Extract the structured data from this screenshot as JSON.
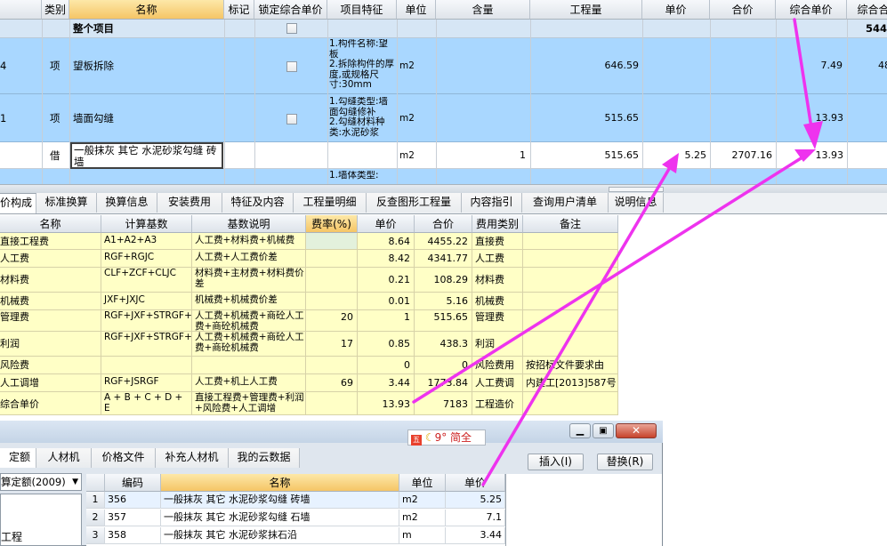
{
  "top_grid": {
    "headers": [
      "类别",
      "名称",
      "标记",
      "锁定综合单价",
      "项目特征",
      "单位",
      "含量",
      "工程量",
      "单价",
      "合价",
      "综合单价",
      "综合合"
    ],
    "summary": {
      "name": "整个项目",
      "total": "544"
    },
    "rows": [
      {
        "idx": "4",
        "type": "项",
        "name": "望板拆除",
        "features": "1.构件名称:望板\n2.拆除构件的厚度,或规格尺寸:30mm",
        "unit": "m2",
        "qty": "646.59",
        "comp_price": "7.49",
        "comp_total": "48"
      },
      {
        "idx": "1",
        "type": "项",
        "name": "墙面勾缝",
        "features": "1.勾缝类型:墙面勾缝修补\n2.勾缝材料种类:水泥砂浆",
        "unit": "m2",
        "qty": "515.65",
        "comp_price": "13.93",
        "comp_total": ""
      },
      {
        "idx": "",
        "type": "借",
        "name": "一般抹灰 其它 水泥砂浆勾缝 砖墙",
        "features": "",
        "unit": "m2",
        "content": "1",
        "qty": "515.65",
        "price": "5.25",
        "total": "2707.16",
        "comp_price": "13.93",
        "comp_total": ""
      },
      {
        "idx": "",
        "type": "",
        "name": "",
        "features": "1.墙体类型:",
        "unit": "",
        "qty": "",
        "comp_price": "",
        "comp_total": ""
      }
    ]
  },
  "tabs": [
    "价构成",
    "标准换算",
    "换算信息",
    "安装费用",
    "特征及内容",
    "工程量明细",
    "反查图形工程量",
    "内容指引",
    "查询用户清单",
    "说明信息"
  ],
  "price_grid": {
    "headers": [
      "名称",
      "计算基数",
      "基数说明",
      "费率(%)",
      "单价",
      "合价",
      "费用类别",
      "备注"
    ],
    "rows": [
      {
        "name": "直接工程费",
        "base": "A1+A2+A3",
        "desc": "人工费+材料费+机械费",
        "rate": "",
        "unit_price": "8.64",
        "total": "4455.22",
        "category": "直接费",
        "note": ""
      },
      {
        "name": "人工费",
        "base": "RGF+RGJC",
        "desc": "人工费+人工费价差",
        "rate": "",
        "unit_price": "8.42",
        "total": "4341.77",
        "category": "人工费",
        "note": ""
      },
      {
        "name": "材料费",
        "base": "CLF+ZCF+CLJC",
        "desc": "材料费+主材费+材料费价差",
        "rate": "",
        "unit_price": "0.21",
        "total": "108.29",
        "category": "材料费",
        "note": ""
      },
      {
        "name": "机械费",
        "base": "JXF+JXJC",
        "desc": "机械费+机械费价差",
        "rate": "",
        "unit_price": "0.01",
        "total": "5.16",
        "category": "机械费",
        "note": ""
      },
      {
        "name": "管理费",
        "base": "RGF+JXF+STRGF+STJXF",
        "desc": "人工费+机械费+商砼人工费+商砼机械费",
        "rate": "20",
        "unit_price": "1",
        "total": "515.65",
        "category": "管理费",
        "note": ""
      },
      {
        "name": "利润",
        "base": "RGF+JXF+STRGF+STJXF",
        "desc": "人工费+机械费+商砼人工费+商砼机械费",
        "rate": "17",
        "unit_price": "0.85",
        "total": "438.3",
        "category": "利润",
        "note": ""
      },
      {
        "name": "风险费",
        "base": "",
        "desc": "",
        "rate": "",
        "unit_price": "0",
        "total": "0",
        "category": "风险费用",
        "note": "按招标文件要求由"
      },
      {
        "name": "人工调增",
        "base": "RGF+JSRGF",
        "desc": "人工费+机上人工费",
        "rate": "69",
        "unit_price": "3.44",
        "total": "1773.84",
        "category": "人工费调",
        "note": "内建工[2013]587号"
      },
      {
        "name": "综合单价",
        "base": "A + B + C + D + E",
        "desc": "直接工程费+管理费+利润+风险费+人工调增",
        "rate": "",
        "unit_price": "13.93",
        "total": "7183",
        "category": "工程造价",
        "note": ""
      }
    ]
  },
  "popup": {
    "ime_text": "9° 简全",
    "tabs": [
      "定额",
      "人材机",
      "价格文件",
      "补充人材机",
      "我的云数据"
    ],
    "insert_label": "插入(I)",
    "replace_label": "替换(R)",
    "dropdown_value": "算定额(2009)",
    "tree_item": "工程",
    "headers": [
      "编码",
      "名称",
      "单位",
      "单价"
    ],
    "rows": [
      {
        "no": "1",
        "code": "356",
        "name": "一般抹灰 其它 水泥砂浆勾缝 砖墙",
        "unit": "m2",
        "price": "5.25"
      },
      {
        "no": "2",
        "code": "357",
        "name": "一般抹灰 其它 水泥砂浆勾缝 石墙",
        "unit": "m2",
        "price": "7.1"
      },
      {
        "no": "3",
        "code": "358",
        "name": "一般抹灰 其它 水泥砂浆抹石沿",
        "unit": "m",
        "price": "3.44"
      }
    ]
  },
  "colors": {
    "selected_row": "#a9d7ff",
    "grid_yellow": "#ffffc6",
    "arrow": "#ee33ee"
  }
}
